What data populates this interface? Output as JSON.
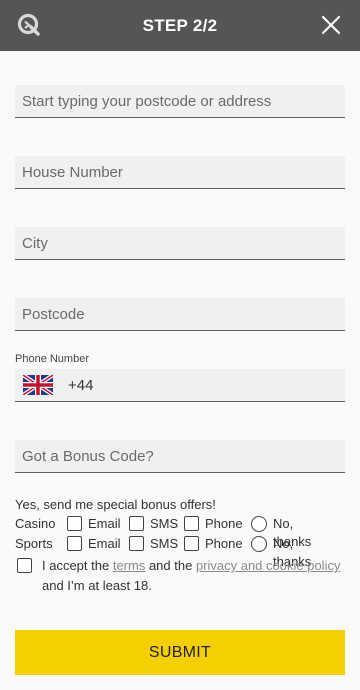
{
  "header": {
    "title": "STEP 2/2",
    "logo_icon": "brand-logo-icon",
    "close_icon": "close-icon"
  },
  "fields": {
    "address_placeholder": "Start typing your postcode or address",
    "house_number_placeholder": "House Number",
    "city_placeholder": "City",
    "postcode_placeholder": "Postcode",
    "bonus_code_placeholder": "Got a Bonus Code?"
  },
  "phone": {
    "label": "Phone Number",
    "dial_code": "+44",
    "flag_icon": "uk-flag-icon"
  },
  "offers": {
    "title": "Yes, send me special bonus offers!",
    "rows": [
      {
        "label": "Casino",
        "options": [
          "Email",
          "SMS",
          "Phone",
          "No, thanks"
        ]
      },
      {
        "label": "Sports",
        "options": [
          "Email",
          "SMS",
          "Phone",
          "No, thanks"
        ]
      }
    ]
  },
  "terms": {
    "prefix": "I accept the ",
    "terms_link": "terms",
    "middle": " and the ",
    "privacy_link": "privacy and cookie policy",
    "suffix": " and I’m at least 18."
  },
  "submit_label": "SUBMIT",
  "colors": {
    "header_bg": "#555555",
    "submit_bg": "#f5d000",
    "link": "#8a8a8a"
  }
}
